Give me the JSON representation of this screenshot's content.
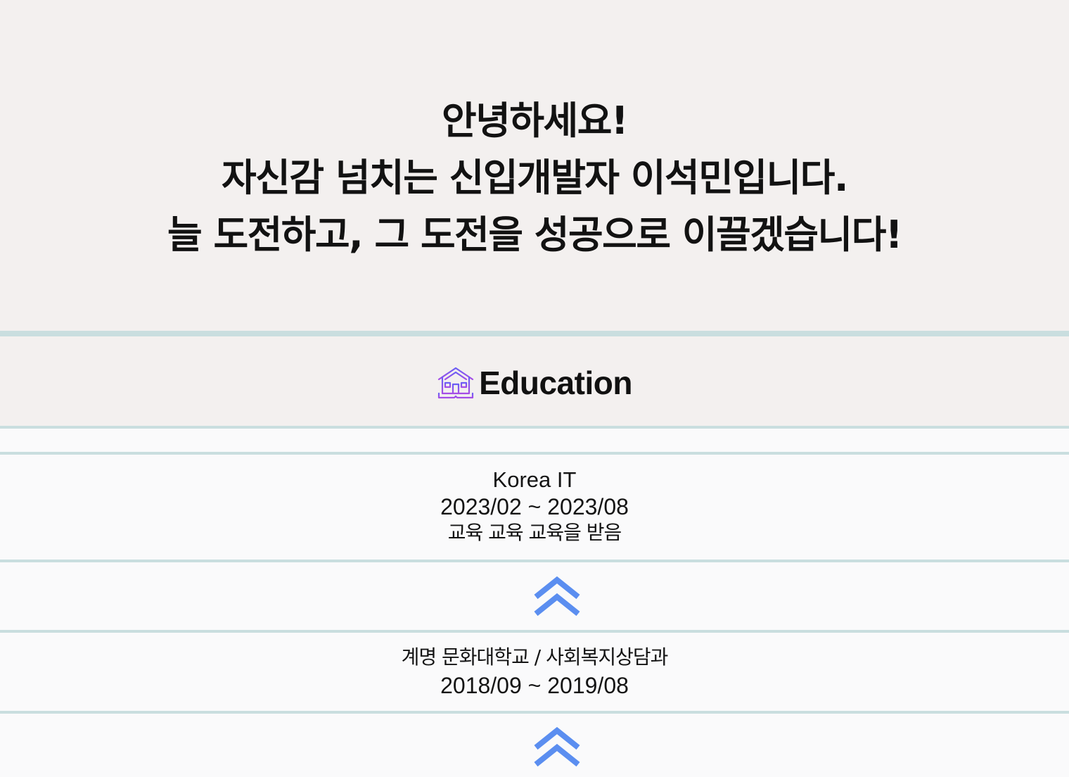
{
  "hero": {
    "lines": [
      "안녕하세요!",
      "자신감 넘치는 신입개발자 이석민입니다.",
      "늘 도전하고, 그 도전을 성공으로 이끌겠습니다!"
    ]
  },
  "education": {
    "title": "Education",
    "icon": "school-icon",
    "entries": [
      {
        "name": "Korea IT",
        "period": "2023/02 ~ 2023/08",
        "description": "교육 교육 교육을 받음"
      },
      {
        "name": "계명 문화대학교 / 사회복지상담과",
        "period": "2018/09 ~ 2019/08"
      }
    ],
    "separator_icon": "double-chevron-up-icon"
  },
  "colors": {
    "hero_bg": "#f3f0ef",
    "body_bg": "#fafafb",
    "divider": "#c9dedf",
    "chevron": "#5b8ef0",
    "icon_stroke_top": "#6a5ef5",
    "icon_stroke_bottom": "#a64de6"
  }
}
